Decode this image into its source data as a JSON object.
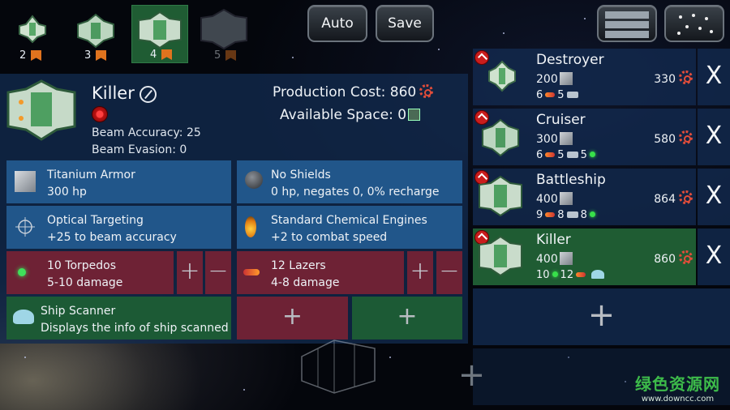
{
  "top": {
    "slots": [
      {
        "number": "2",
        "active": false
      },
      {
        "number": "3",
        "active": false
      },
      {
        "number": "4",
        "active": true
      },
      {
        "number": "5",
        "active": false
      }
    ],
    "auto_label": "Auto",
    "save_label": "Save"
  },
  "design": {
    "name": "Killer",
    "beam_accuracy": "Beam Accuracy: 25",
    "beam_evasion": "Beam Evasion: 0",
    "production_cost": "Production Cost: 860",
    "available_space": "Available Space: 0"
  },
  "modules": [
    {
      "name": "Titanium Armor",
      "detail": "300 hp",
      "icon": "armor-plate-icon"
    },
    {
      "name": "No Shields",
      "detail": "0 hp, negates 0, 0% recharge",
      "icon": "shield-orb-icon"
    },
    {
      "name": "Optical Targeting",
      "detail": "+25 to beam accuracy",
      "icon": "crosshair-icon"
    },
    {
      "name": "Standard Chemical Engines",
      "detail": "+2 to combat speed",
      "icon": "engine-flame-icon"
    },
    {
      "name": "10 Torpedos",
      "detail": "5-10 damage",
      "icon": "torpedo-icon"
    },
    {
      "name": "12 Lazers",
      "detail": "4-8 damage",
      "icon": "laser-icon"
    },
    {
      "name": "Ship Scanner",
      "detail": "Displays the info of ship scanned",
      "icon": "scanner-icon"
    }
  ],
  "controls": {
    "plus": "+",
    "minus": "−",
    "close": "X"
  },
  "fleet": [
    {
      "name": "Destroyer",
      "hp": "200",
      "cost": "330",
      "weapons": [
        "6",
        "5"
      ]
    },
    {
      "name": "Cruiser",
      "hp": "300",
      "cost": "580",
      "weapons": [
        "6",
        "5",
        "5"
      ]
    },
    {
      "name": "Battleship",
      "hp": "400",
      "cost": "864",
      "weapons": [
        "9",
        "8",
        "8"
      ]
    },
    {
      "name": "Killer",
      "hp": "400",
      "cost": "860",
      "weapons": [
        "10",
        "12"
      ]
    }
  ],
  "watermark": {
    "line1": "绿色资源网",
    "line2": "www.downcc.com"
  },
  "colors": {
    "panel_blue": "#21568a",
    "weapon_red": "#6e2235",
    "active_green": "#1c5a35",
    "accent_orange": "#e0731e"
  }
}
